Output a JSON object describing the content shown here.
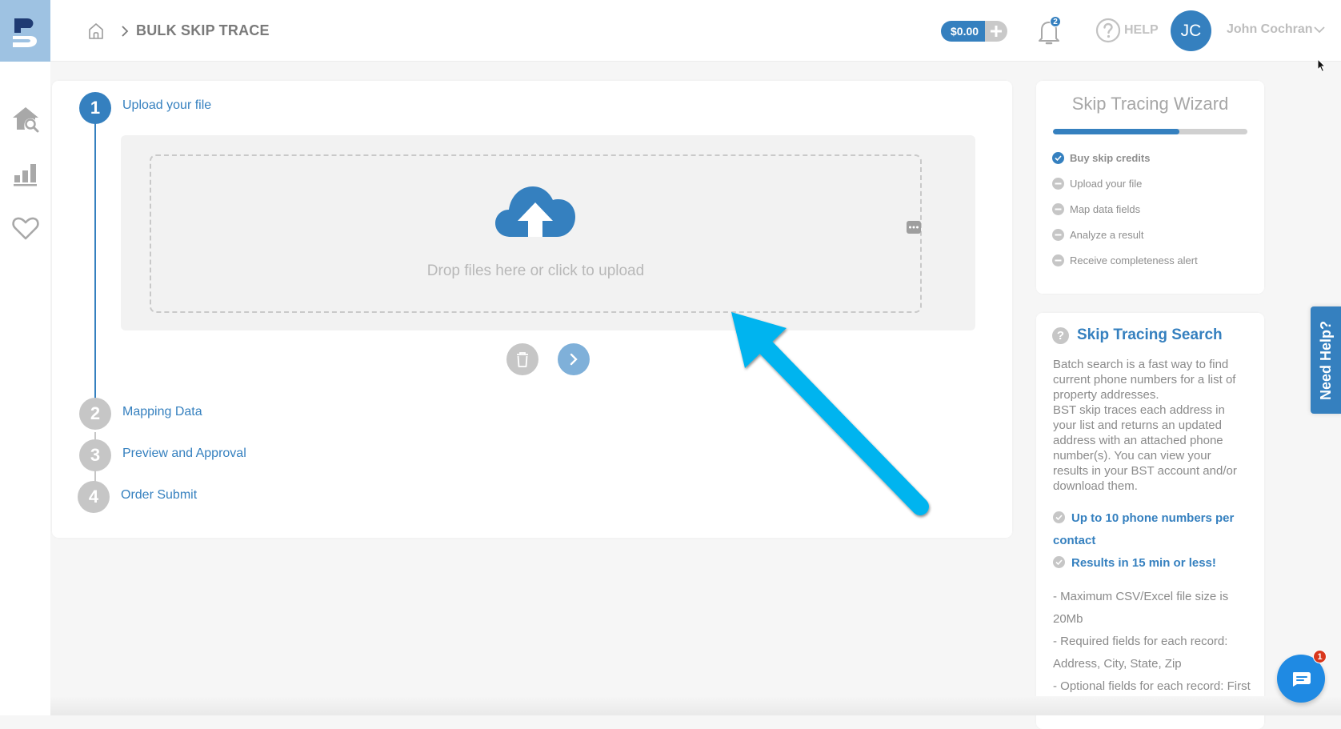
{
  "header": {
    "logo": "BST logo",
    "breadcrumb": {
      "home_icon": "home-icon",
      "separator_icon": "chevron-right-icon",
      "title": "BULK SKIP TRACE"
    },
    "balance": {
      "amount": "$0.00",
      "add_icon": "plus-icon"
    },
    "notifications": {
      "icon": "bell-icon",
      "count": "2"
    },
    "help": {
      "icon": "question-circle-icon",
      "label": "HELP"
    },
    "user": {
      "initials": "JC",
      "name": "John Cochran",
      "menu_icon": "chevron-down-icon"
    }
  },
  "sidebar": {
    "items": [
      {
        "name": "property-search",
        "icon": "house-search-icon"
      },
      {
        "name": "analytics",
        "icon": "bar-chart-icon"
      },
      {
        "name": "favorites",
        "icon": "heart-icon"
      }
    ]
  },
  "steps": [
    {
      "number": "1",
      "label": "Upload your file",
      "active": true
    },
    {
      "number": "2",
      "label": "Mapping Data",
      "active": false
    },
    {
      "number": "3",
      "label": "Preview and Approval",
      "active": false
    },
    {
      "number": "4",
      "label": "Order Submit",
      "active": false
    }
  ],
  "upload": {
    "icon": "cloud-upload-icon",
    "prompt": "Drop files here or click to upload",
    "delete_icon": "trash-icon",
    "next_icon": "chevron-right-icon",
    "more_icon": "more-icon"
  },
  "wizard": {
    "title": "Skip Tracing Wizard",
    "progress_percent": 65,
    "items": [
      {
        "label": "Buy skip credits",
        "done": true
      },
      {
        "label": "Upload your file",
        "done": false
      },
      {
        "label": "Map data fields",
        "done": false
      },
      {
        "label": "Analyze a result",
        "done": false
      },
      {
        "label": "Receive completeness alert",
        "done": false
      }
    ]
  },
  "info": {
    "title": "Skip Tracing Search",
    "description_1": "Batch search is a fast way to find current phone numbers for a list of property addresses.",
    "description_2": "BST skip traces each address in your list and returns an updated address with an attached phone number(s). You can view your results in your BST account and/or download them.",
    "features": [
      "Up to 10 phone numbers per contact",
      "Results in 15 min or less!"
    ],
    "notes": [
      "- Maximum CSV/Excel file size is 20Mb",
      "- Required fields for each record: Address, City, State, Zip",
      "- Optional fields for each record: First and Last Names"
    ]
  },
  "need_help": {
    "label": "Need Help?"
  },
  "chat": {
    "icon": "chat-icon",
    "badge": "1"
  },
  "colors": {
    "accent": "#3580bf",
    "arrow": "#06b4ef",
    "inactive": "#c6c6c6",
    "chat": "#1f8ae3",
    "badge_red": "#d9371c"
  }
}
